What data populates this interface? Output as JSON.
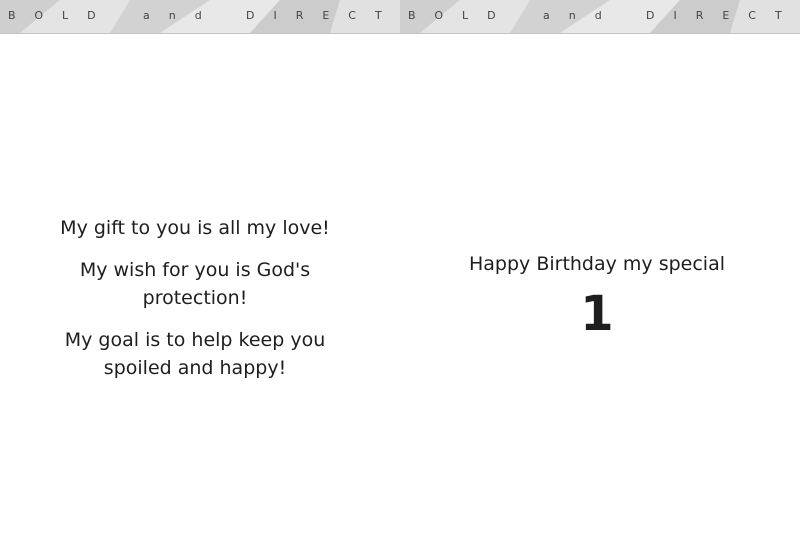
{
  "banner": {
    "left": {
      "word1": "BOLD",
      "word2": "and",
      "word3": "DIRECT"
    },
    "right": {
      "word1": "BOLD",
      "word2": "and",
      "word3": "DIRECT"
    }
  },
  "left_page": {
    "line1": "My gift to you is all my love!",
    "line2": "My wish for you is God's protection!",
    "line3": "My goal is to help keep you spoiled and happy!"
  },
  "right_page": {
    "greeting": "Happy Birthday my special",
    "number": "1"
  }
}
